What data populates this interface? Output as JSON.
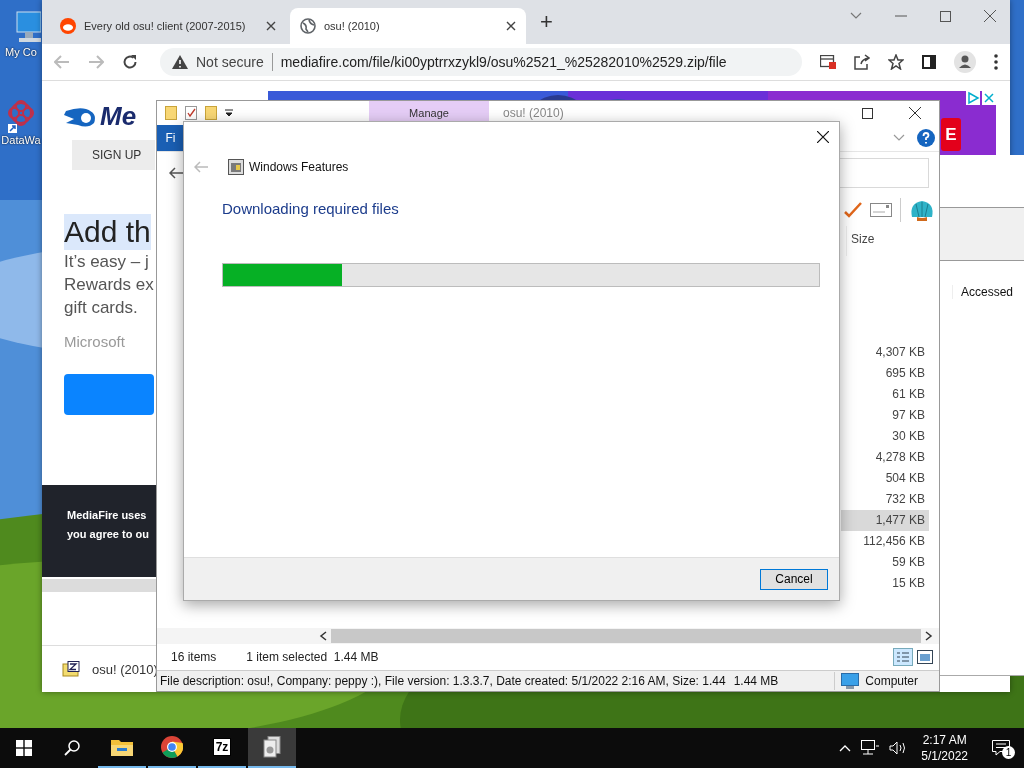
{
  "desktop": {
    "icons": [
      {
        "kind": "computer",
        "label": "My Co"
      },
      {
        "kind": "flower",
        "label": "DataWa"
      }
    ]
  },
  "browser": {
    "tabs": [
      {
        "title": "Every old osu! client (2007-2015)",
        "selected": false
      },
      {
        "title": "osu! (2010)",
        "selected": true
      }
    ],
    "new_tab": "+",
    "security": "Not secure",
    "url": "mediafire.com/file/ki00yptrrxzykl9/osu%2521_%25282010%2529.zip/file",
    "page": {
      "logo": "Me",
      "sign_up": "SIGN UP",
      "ad_badge": "E",
      "heading": "Add th",
      "body_lines": [
        "It’s easy – j",
        "Rewards ex",
        "gift cards."
      ],
      "source": "Microsoft",
      "cookie_lines": [
        "MediaFire uses",
        "you agree to ou"
      ]
    },
    "download": {
      "file": "osu! (2010)"
    }
  },
  "back_window": {
    "column": "Accessed"
  },
  "explorer": {
    "title": "osu! (2010)",
    "context_tab": "Manage",
    "ribbon_tab": "Fi",
    "size_header": "Size",
    "rows": [
      {
        "size": "4,307 KB",
        "selected": false
      },
      {
        "size": "695 KB",
        "selected": false
      },
      {
        "size": "61 KB",
        "selected": false
      },
      {
        "size": "97 KB",
        "selected": false
      },
      {
        "size": "30 KB",
        "selected": false
      },
      {
        "size": "4,278 KB",
        "selected": false
      },
      {
        "size": "504 KB",
        "selected": false
      },
      {
        "size": "732 KB",
        "selected": false
      },
      {
        "size": "1,477 KB",
        "selected": true
      },
      {
        "size": "112,456 KB",
        "selected": false
      },
      {
        "size": "59 KB",
        "selected": false
      },
      {
        "size": "15 KB",
        "selected": false
      }
    ],
    "item_count": "16 items",
    "selection": "1 item selected  1.44 MB",
    "details": "File description: osu!, Company: peppy :), File version: 1.3.3.7, Date created: 5/1/2022 2:16 AM, Size: 1.44",
    "details_size": "1.44 MB",
    "location": "Computer"
  },
  "dialog": {
    "title": "Windows Features",
    "heading": "Downloading required files",
    "progress": {
      "level": 0.2
    },
    "cancel": "Cancel"
  },
  "taskbar": {
    "apps": [
      {
        "kind": "folder",
        "selected": false
      },
      {
        "kind": "chrome",
        "selected": false
      },
      {
        "kind": "archive",
        "label": "7z",
        "selected": false
      },
      {
        "kind": "setup",
        "selected": true
      }
    ],
    "time": "2:17 AM",
    "date": "5/1/2022",
    "notifications": "1"
  }
}
